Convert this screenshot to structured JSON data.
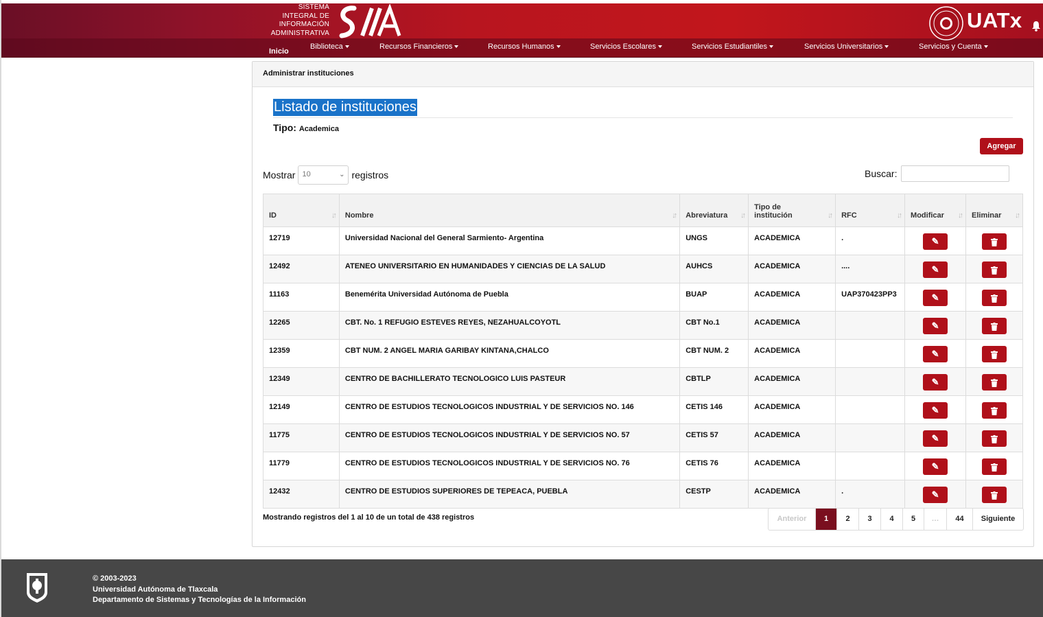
{
  "header": {
    "system_name_lines": [
      "SISTEMA",
      "INTEGRAL DE",
      "INFORMACIÓN",
      "ADMINISTRATIVA"
    ],
    "logo_text": "SIIA",
    "university_logo_text": "UATx",
    "nav": {
      "home": "Inicio",
      "items": [
        "Biblioteca",
        "Recursos Financieros",
        "Recursos Humanos",
        "Servicios Escolares",
        "Servicios Estudiantiles",
        "Servicios Universitarios",
        "Servicios y Cuenta"
      ]
    }
  },
  "panel": {
    "heading": "Administrar instituciones",
    "title": "Listado de instituciones",
    "tipo_label": "Tipo:",
    "tipo_value": "Academica",
    "add_button": "Agregar",
    "show_label": "Mostrar",
    "show_value": "10",
    "records_label": "registros",
    "search_label": "Buscar:",
    "search_value": ""
  },
  "table": {
    "columns": [
      "ID",
      "Nombre",
      "Abreviatura",
      "Tipo de institución",
      "RFC",
      "Modificar",
      "Eliminar"
    ],
    "rows": [
      {
        "id": "12719",
        "nombre": "Universidad Nacional del General Sarmiento- Argentina",
        "abreviatura": "UNGS",
        "tipo": "ACADEMICA",
        "rfc": "."
      },
      {
        "id": "12492",
        "nombre": "ATENEO UNIVERSITARIO EN HUMANIDADES Y CIENCIAS DE LA SALUD",
        "abreviatura": "AUHCS",
        "tipo": "ACADEMICA",
        "rfc": "...."
      },
      {
        "id": "11163",
        "nombre": "Benemérita Universidad Autónoma de Puebla",
        "abreviatura": "BUAP",
        "tipo": "ACADEMICA",
        "rfc": "UAP370423PP3"
      },
      {
        "id": "12265",
        "nombre": "CBT. No. 1 REFUGIO ESTEVES REYES, NEZAHUALCOYOTL",
        "abreviatura": "CBT No.1",
        "tipo": "ACADEMICA",
        "rfc": ""
      },
      {
        "id": "12359",
        "nombre": "CBT NUM. 2 ANGEL MARIA GARIBAY KINTANA,CHALCO",
        "abreviatura": "CBT NUM. 2",
        "tipo": "ACADEMICA",
        "rfc": ""
      },
      {
        "id": "12349",
        "nombre": "CENTRO DE BACHILLERATO TECNOLOGICO LUIS PASTEUR",
        "abreviatura": "CBTLP",
        "tipo": "ACADEMICA",
        "rfc": ""
      },
      {
        "id": "12149",
        "nombre": "CENTRO DE ESTUDIOS TECNOLOGICOS INDUSTRIAL Y DE SERVICIOS NO. 146",
        "abreviatura": "CETIS 146",
        "tipo": "ACADEMICA",
        "rfc": ""
      },
      {
        "id": "11775",
        "nombre": "CENTRO DE ESTUDIOS TECNOLOGICOS INDUSTRIAL Y DE SERVICIOS NO. 57",
        "abreviatura": "CETIS 57",
        "tipo": "ACADEMICA",
        "rfc": ""
      },
      {
        "id": "11779",
        "nombre": "CENTRO DE ESTUDIOS TECNOLOGICOS INDUSTRIAL Y DE SERVICIOS NO. 76",
        "abreviatura": "CETIS 76",
        "tipo": "ACADEMICA",
        "rfc": ""
      },
      {
        "id": "12432",
        "nombre": "CENTRO DE ESTUDIOS SUPERIORES DE TEPEACA, PUEBLA",
        "abreviatura": "CESTP",
        "tipo": "ACADEMICA",
        "rfc": "."
      }
    ]
  },
  "info": "Mostrando registros del 1 al 10 de un total de 438 registros",
  "pagination": {
    "previous": "Anterior",
    "pages": [
      "1",
      "2",
      "3",
      "4",
      "5",
      "…",
      "44"
    ],
    "active": "1",
    "next": "Siguiente"
  },
  "footer": {
    "copyright": "© 2003-2023",
    "university": "Universidad Autónoma de Tlaxcala",
    "department": "Departamento de Sistemas y Tecnologías de la Información"
  },
  "colors": {
    "brand_red": "#b0101a",
    "header_dark": "#6a0f26",
    "active_page": "#7a0f1f",
    "footer_bg": "#474747",
    "title_highlight": "#1a73c9"
  }
}
